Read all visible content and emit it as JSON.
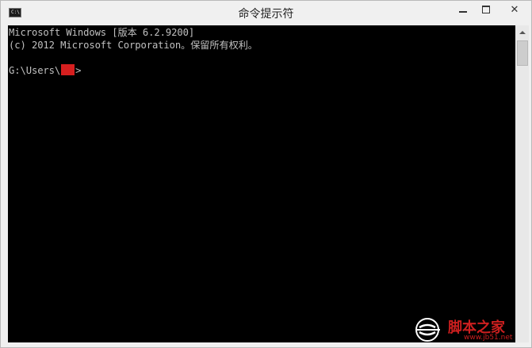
{
  "window": {
    "title": "命令提示符",
    "app_icon_text": "C:\\"
  },
  "console": {
    "lines": [
      "Microsoft Windows [版本 6.2.9200]",
      "(c) 2012 Microsoft Corporation。保留所有权利。"
    ],
    "prompt_prefix": "G:\\Users\\",
    "prompt_suffix": ">"
  },
  "watermark": {
    "text": "脚本之家",
    "url": "www.jb51.net"
  },
  "colors": {
    "console_bg": "#000000",
    "console_fg": "#c0c0c0",
    "redaction": "#d61f1f",
    "watermark": "#cc1f1f"
  },
  "icons": [
    "cmd-app-icon",
    "minimize-icon",
    "maximize-icon",
    "close-icon",
    "scroll-up-arrow-icon"
  ]
}
